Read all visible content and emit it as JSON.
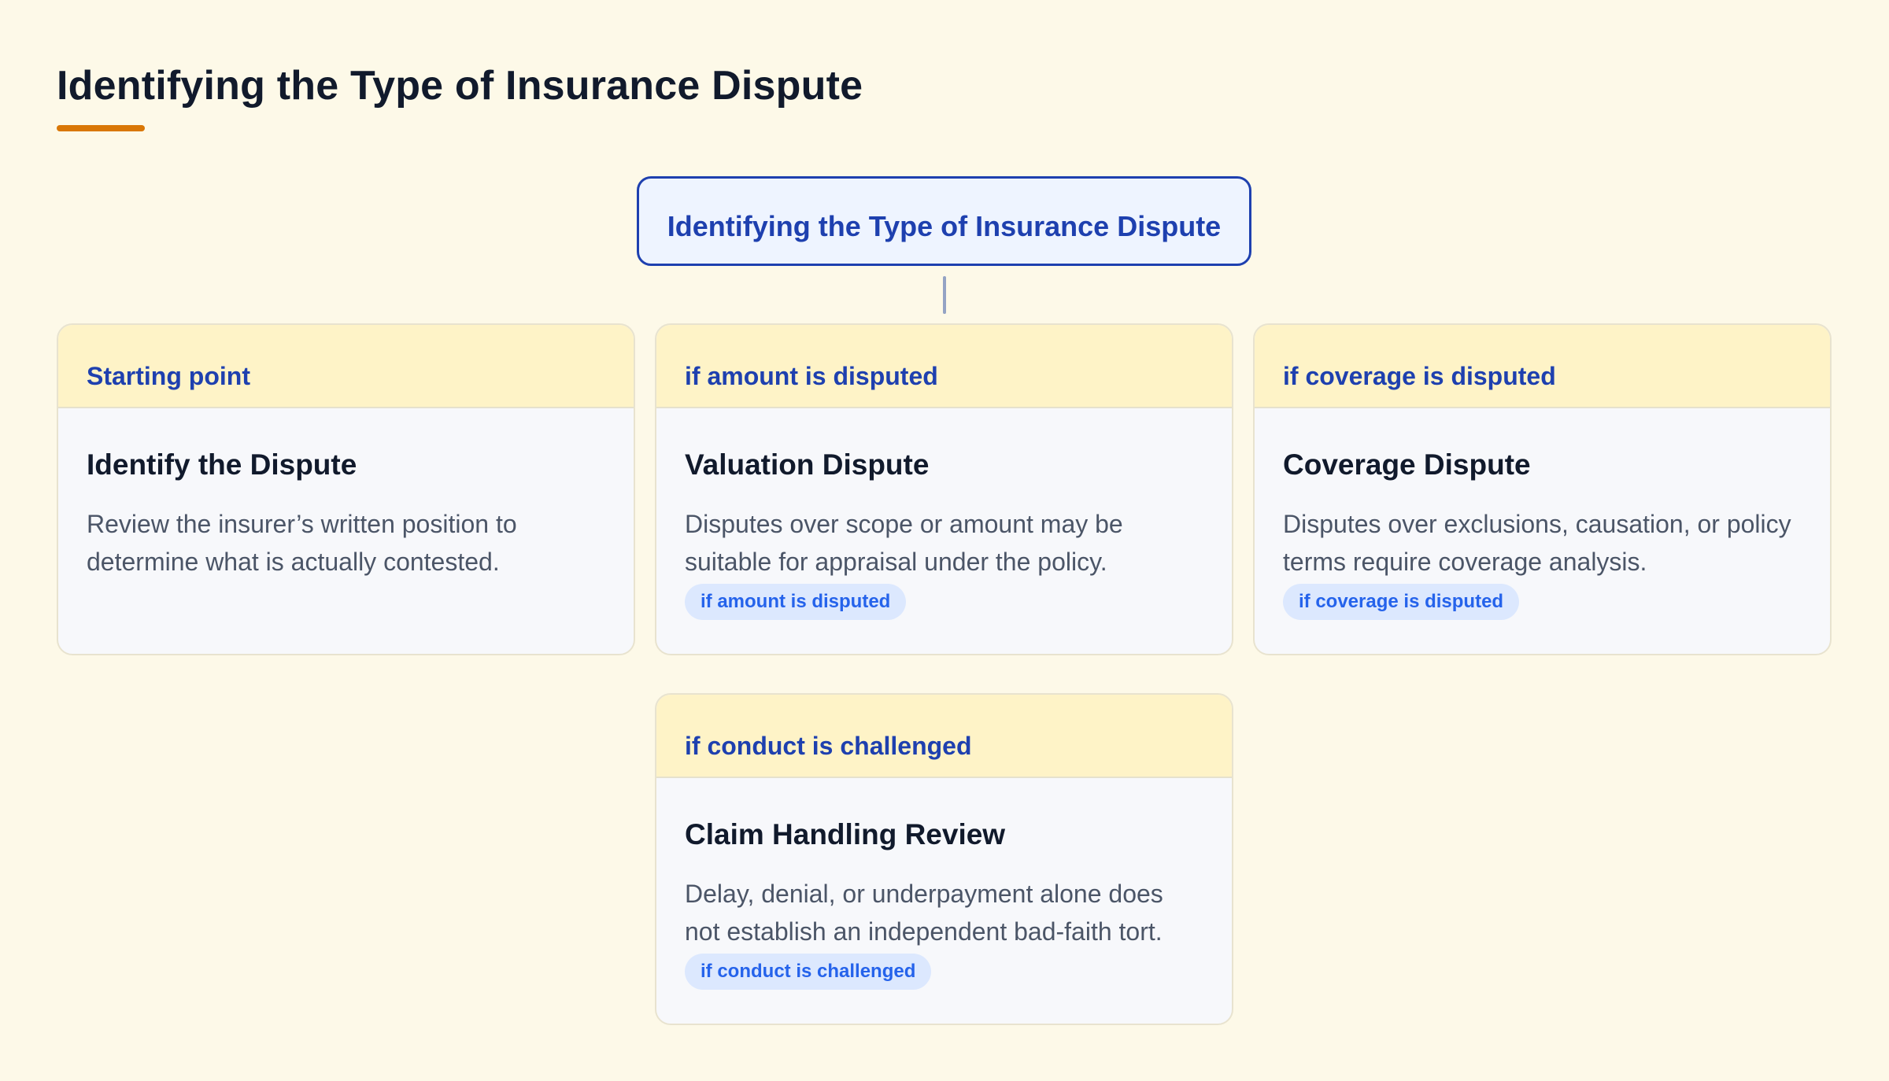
{
  "page": {
    "title": "Identifying the Type of Insurance Dispute"
  },
  "root": {
    "label": "Identifying the Type of Insurance Dispute"
  },
  "cards": [
    {
      "header": "Starting point",
      "title": "Identify the Dispute",
      "description": "Review the insurer’s written position to determine what is actually contested.",
      "tag": ""
    },
    {
      "header": "if amount is disputed",
      "title": "Valuation Dispute",
      "description": "Disputes over scope or amount may be suitable for appraisal under the policy.",
      "tag": "if amount is disputed"
    },
    {
      "header": "if coverage is disputed",
      "title": "Coverage Dispute",
      "description": "Disputes over exclusions, causation, or policy terms require coverage analysis.",
      "tag": "if coverage is disputed"
    },
    {
      "header": "if conduct is challenged",
      "title": "Claim Handling Review",
      "description": "Delay, denial, or underpayment alone does not establish an independent bad-faith tort.",
      "tag": "if conduct is challenged"
    }
  ],
  "colors": {
    "background": "#fdf9e8",
    "accent": "#d97706",
    "primary": "#1e40af",
    "header_fill": "#fef3c7",
    "pill_fill": "#dce8fe",
    "pill_text": "#2563eb"
  }
}
